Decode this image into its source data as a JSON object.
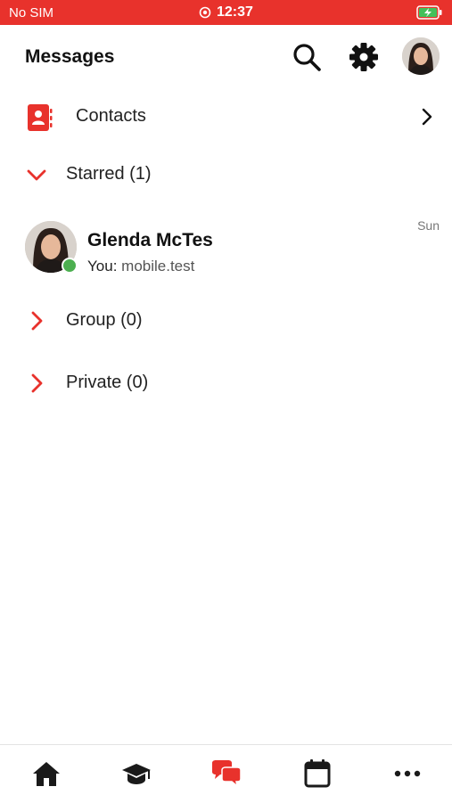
{
  "status_bar": {
    "carrier": "No SIM",
    "time": "12:37",
    "battery": "charging"
  },
  "header": {
    "title": "Messages"
  },
  "contacts": {
    "label": "Contacts"
  },
  "sections": {
    "starred": {
      "label": "Starred (1)",
      "expanded": true
    },
    "group": {
      "label": "Group (0)",
      "expanded": false
    },
    "private": {
      "label": "Private (0)",
      "expanded": false
    }
  },
  "conversation": {
    "name": "Glenda McTes",
    "preview_prefix": "You:",
    "preview_text": "mobile.test",
    "time": "Sun",
    "online": true
  },
  "tabs": [
    {
      "icon": "home-icon",
      "active": false
    },
    {
      "icon": "graduation-cap-icon",
      "active": false
    },
    {
      "icon": "chat-bubbles-icon",
      "active": true
    },
    {
      "icon": "calendar-icon",
      "active": false
    },
    {
      "icon": "more-icon",
      "active": false
    }
  ],
  "colors": {
    "accent": "#e8322c",
    "online": "#4caf50",
    "icon_dark": "#1a1a1a"
  }
}
